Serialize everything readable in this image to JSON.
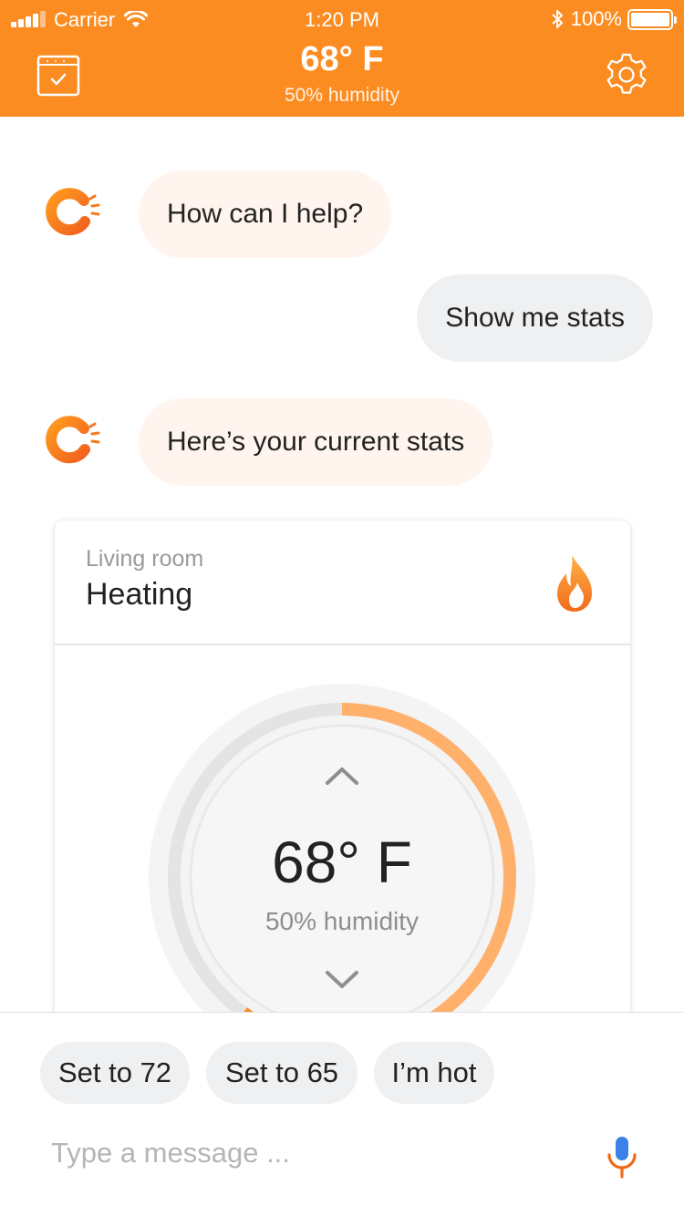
{
  "status_bar": {
    "carrier": "Carrier",
    "time": "1:20 PM",
    "battery": "100%",
    "battery_level": 1.0
  },
  "header": {
    "temperature": "68° F",
    "humidity": "50% humidity",
    "calendar_icon": "calendar-check-icon",
    "settings_icon": "gear-icon",
    "background_color": "#fb8c22"
  },
  "chat": {
    "messages": [
      {
        "sender": "bot",
        "text": "How can I help?"
      },
      {
        "sender": "user",
        "text": "Show me stats"
      },
      {
        "sender": "bot",
        "text": "Here’s your current stats"
      }
    ]
  },
  "card": {
    "room": "Living room",
    "mode": "Heating",
    "mode_icon": "flame-icon",
    "temperature": "68° F",
    "humidity": "50% humidity",
    "dial_fill_fraction": 0.6
  },
  "quick_replies": [
    "Set to 72",
    "Set to 65",
    "I’m hot"
  ],
  "composer": {
    "placeholder": "Type a message ...",
    "mic_icon": "microphone-icon"
  },
  "colors": {
    "accent": "#fb8c22",
    "bot_bubble": "#fff4ee",
    "user_bubble": "#eff0f1"
  }
}
